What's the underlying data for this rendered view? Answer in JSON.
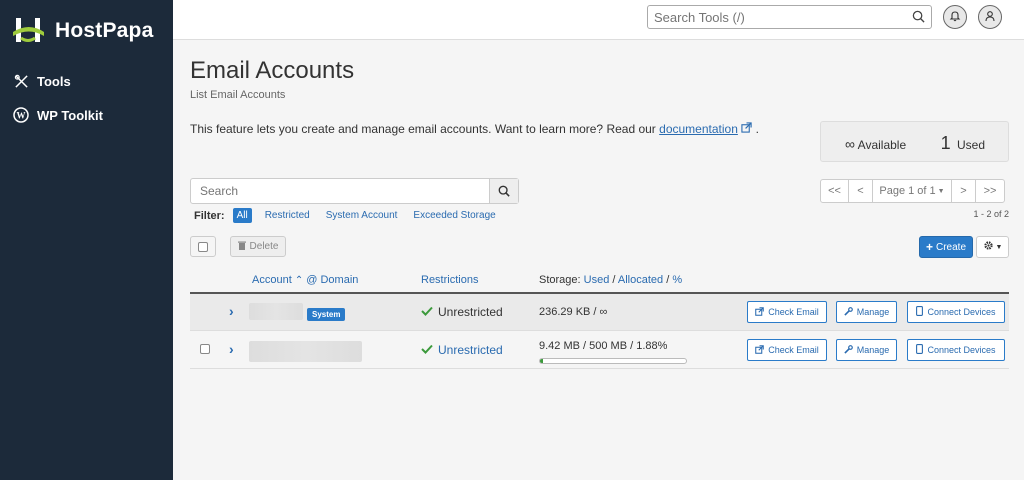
{
  "brand": {
    "name": "HostPapa",
    "color": "#1c2a3a",
    "accent": "#2a7bc9"
  },
  "sidebar": {
    "items": [
      {
        "label": "Tools",
        "icon": "tools-icon"
      },
      {
        "label": "WP Toolkit",
        "icon": "wordpress-icon"
      }
    ]
  },
  "topbar": {
    "search_placeholder": "Search Tools (/)",
    "icons": [
      "search-icon",
      "bell-icon",
      "user-icon"
    ]
  },
  "page": {
    "title": "Email Accounts",
    "subtitle": "List Email Accounts",
    "intro_text": "This feature lets you create and manage email accounts. Want to learn more? Read our",
    "intro_link": "documentation",
    "intro_end": "."
  },
  "stats": {
    "available_symbol": "∞",
    "available_label": "Available",
    "used_count": "1",
    "used_label": "Used"
  },
  "search": {
    "placeholder": "Search"
  },
  "filter": {
    "label": "Filter:",
    "options": [
      "All",
      "Restricted",
      "System Account",
      "Exceeded Storage"
    ],
    "active": "All"
  },
  "pagination": {
    "first": "<<",
    "prev": "<",
    "page_label": "Page 1 of 1",
    "next": ">",
    "last": ">>",
    "range": "1 - 2 of 2"
  },
  "actions": {
    "delete_label": "Delete",
    "create_label": "Create"
  },
  "table": {
    "headers": {
      "account": "Account",
      "at_domain": "@ Domain",
      "restrictions": "Restrictions",
      "storage_prefix": "Storage:",
      "used": "Used",
      "allocated": "Allocated",
      "percent": "%"
    },
    "rows": [
      {
        "badge": "System",
        "restriction": "Unrestricted",
        "storage": "236.29 KB / ∞",
        "buttons": [
          "Check Email",
          "Manage",
          "Connect Devices"
        ]
      },
      {
        "badge": "",
        "restriction": "Unrestricted",
        "storage": "9.42 MB / 500 MB / 1.88%",
        "usage_fraction": 0.0188,
        "buttons": [
          "Check Email",
          "Manage",
          "Connect Devices"
        ]
      }
    ]
  }
}
